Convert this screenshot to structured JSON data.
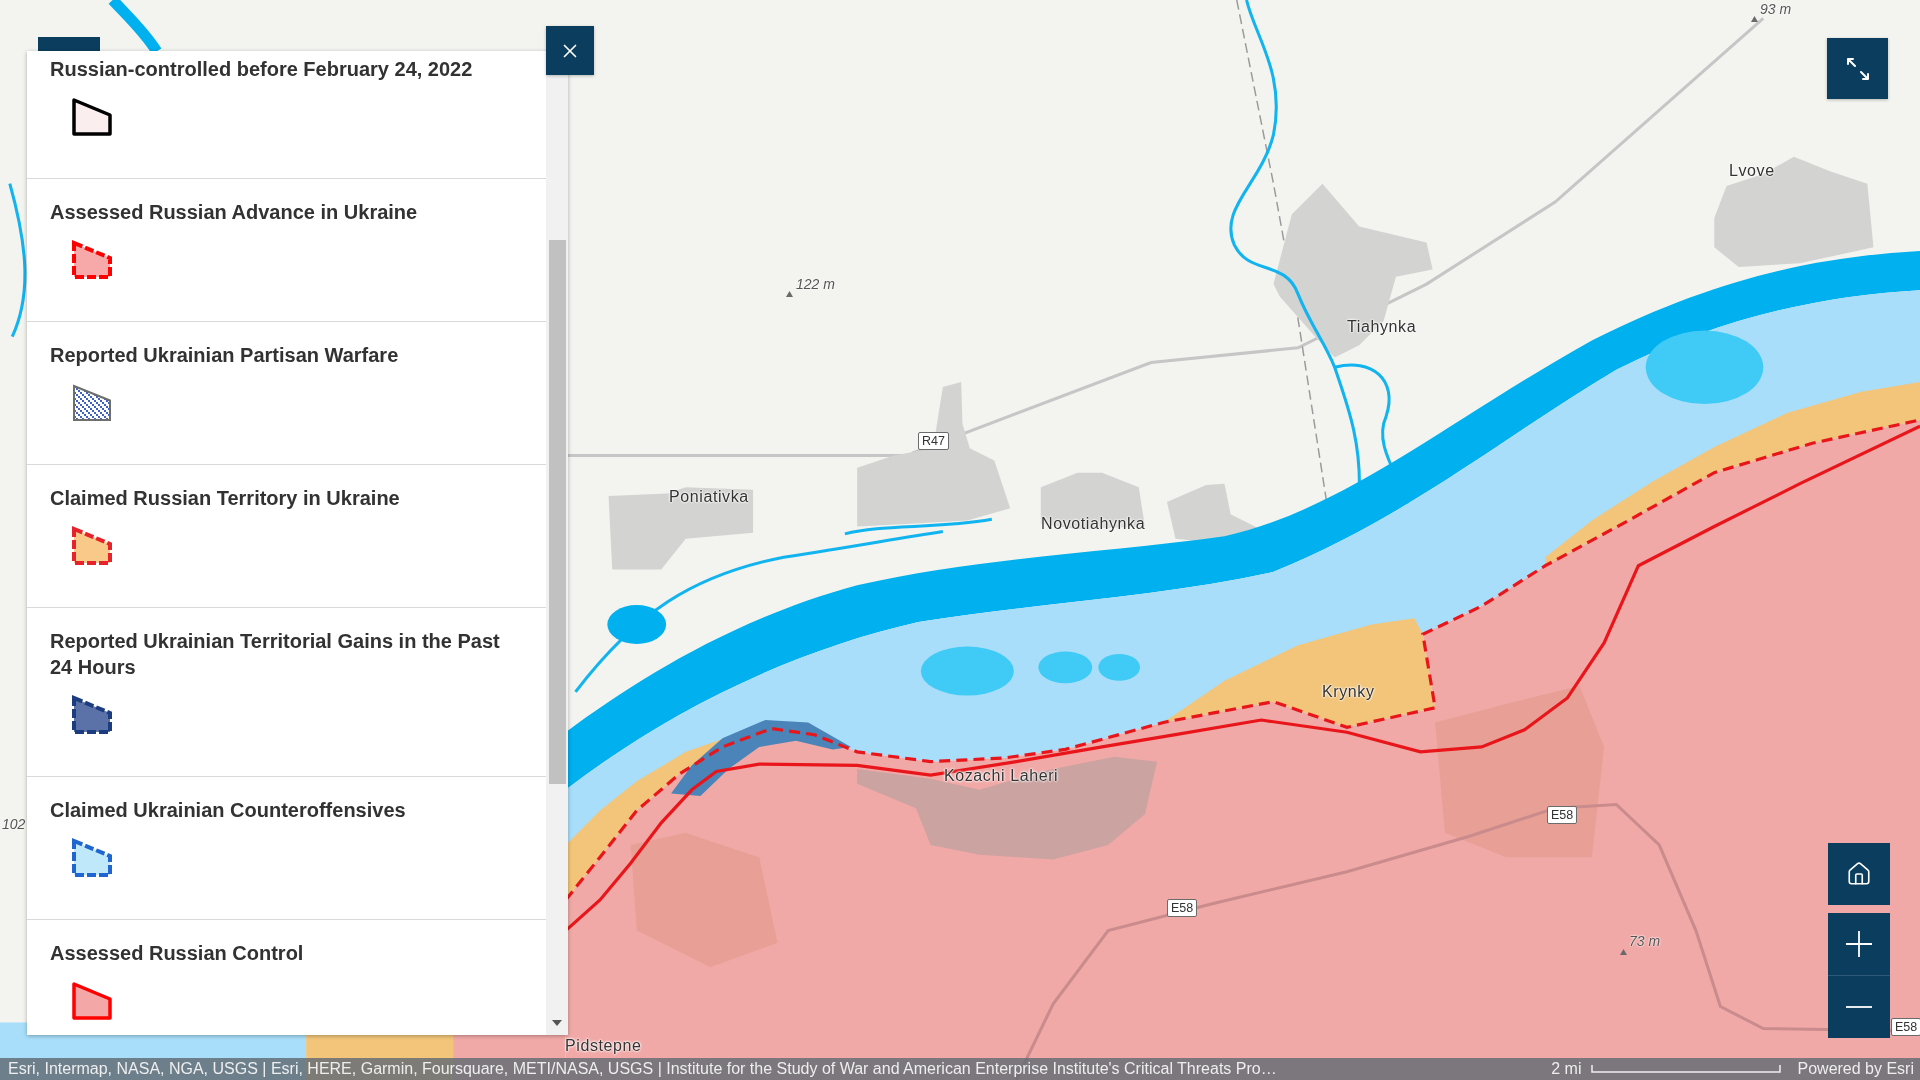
{
  "legend": {
    "items": [
      {
        "label": "Russian-controlled before February 24, 2022",
        "kind": "solid",
        "fill": {
          "color": "#fbeeee"
        },
        "outline": {
          "color": "#000000"
        }
      },
      {
        "label": "Assessed Russian Advance in Ukraine",
        "kind": "dashed",
        "fill": {
          "color": "#f7a9a9"
        },
        "outline": {
          "color": "#ff0000"
        }
      },
      {
        "label": "Reported Ukrainian Partisan Warfare",
        "kind": "hatched",
        "fill": {
          "color": "#3f63c4"
        },
        "outline": {
          "color": "#6e6e6e"
        }
      },
      {
        "label": "Claimed Russian Territory in Ukraine",
        "kind": "dashed",
        "fill": {
          "color": "#f9c98a"
        },
        "outline": {
          "color": "#e8222a"
        }
      },
      {
        "label": "Reported Ukrainian Territorial Gains in the Past 24 Hours",
        "kind": "dashed",
        "fill": {
          "color": "#5a72a8"
        },
        "outline": {
          "color": "#1c3c80"
        }
      },
      {
        "label": "Claimed Ukrainian Counteroffensives",
        "kind": "dashed",
        "fill": {
          "color": "#bfe8fa"
        },
        "outline": {
          "color": "#1f66d1"
        }
      },
      {
        "label": "Assessed Russian Control",
        "kind": "solid",
        "fill": {
          "color": "#f4a7a7"
        },
        "outline": {
          "color": "#ff0000"
        }
      }
    ]
  },
  "map": {
    "labels": [
      {
        "text": "93 m",
        "kind": "elevation"
      },
      {
        "text": "Lvove",
        "kind": "place"
      },
      {
        "text": "Tiahynka",
        "kind": "place"
      },
      {
        "text": "122 m",
        "kind": "elevation"
      },
      {
        "text": "R47",
        "kind": "road"
      },
      {
        "text": "Poniativka",
        "kind": "place"
      },
      {
        "text": "Novotiahynka",
        "kind": "place"
      },
      {
        "text": "Krynky",
        "kind": "place"
      },
      {
        "text": "Kozachi Laheri",
        "kind": "place"
      },
      {
        "text": "E58",
        "kind": "road"
      },
      {
        "text": "102",
        "kind": "elevation"
      },
      {
        "text": "E58",
        "kind": "road"
      },
      {
        "text": "73 m",
        "kind": "elevation"
      },
      {
        "text": "E58",
        "kind": "road"
      },
      {
        "text": "Pidstepne",
        "kind": "place"
      }
    ]
  },
  "attribution": {
    "text": "Esri, Intermap, NASA, NGA, USGS | Esri, HERE, Garmin, Foursquare, METI/NASA, USGS | Institute for the Study of War and American Enterprise Institute's Critical Threats Pro…",
    "scale": "2 mi",
    "powered_by": "Powered by Esri"
  }
}
